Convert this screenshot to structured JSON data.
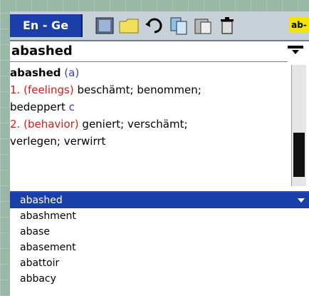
{
  "toolbar": {
    "lang_label": "En - Ge",
    "icons": [
      "book-icon",
      "folder-icon",
      "undo-icon",
      "copy-icon",
      "copy-icon",
      "trash-icon"
    ],
    "ab_label": "ab-"
  },
  "entry": {
    "headword": "abashed",
    "line1_word": "abashed",
    "line1_pos": "(a)",
    "sense1_num": "1.",
    "sense1_context": "(feelings)",
    "sense1_text": "beschämt; benommen;",
    "sense1_cont": "bedeppert",
    "sense1_mark": "c",
    "sense2_num": "2.",
    "sense2_context": "(behavior)",
    "sense2_text": "geniert; verschämt;",
    "sense2_cont": "verlegen; verwirrt"
  },
  "list": {
    "items": [
      "abashed",
      "abashment",
      "abase",
      "abasement",
      "abattoir",
      "abbacy"
    ],
    "selected_index": 0
  },
  "colors": {
    "accent": "#1b3fa8",
    "pos": "#3140c8",
    "context": "#d81a1a"
  }
}
